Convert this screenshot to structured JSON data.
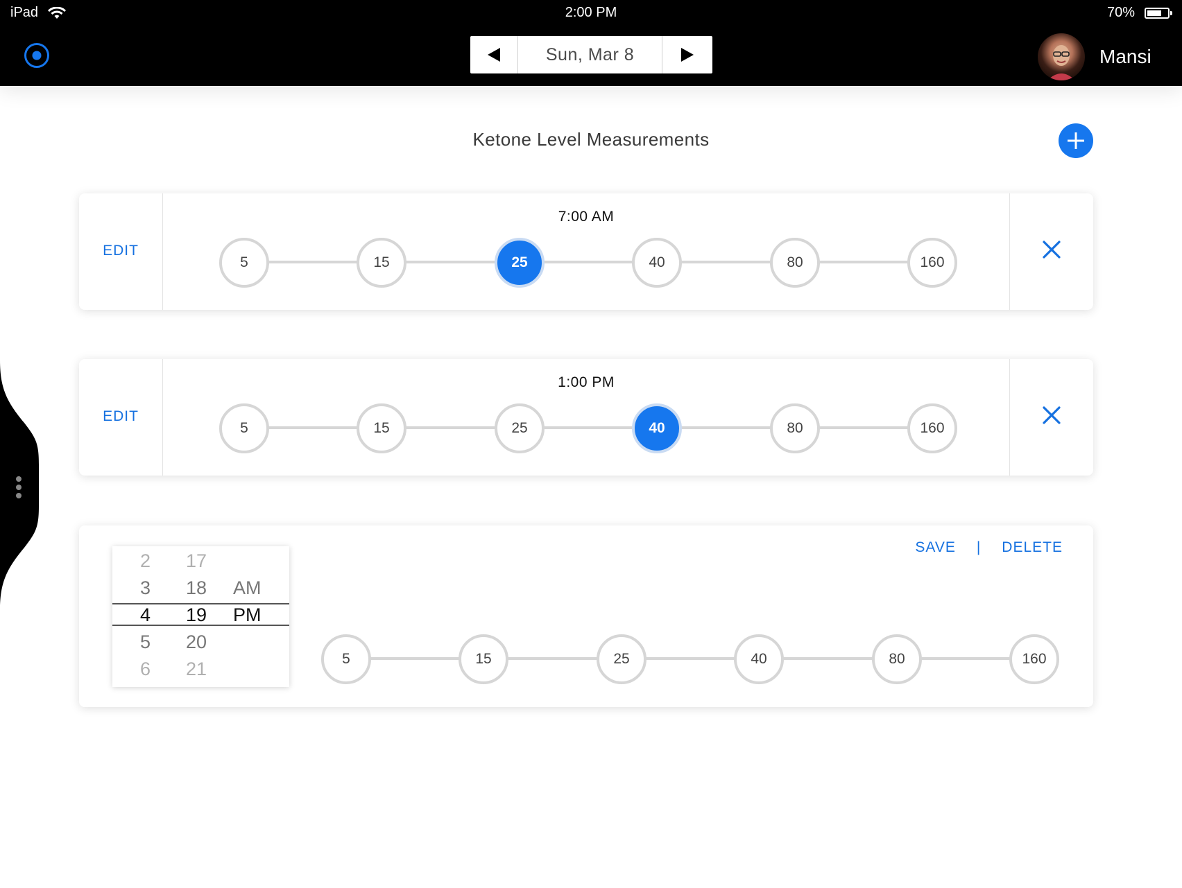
{
  "status_bar": {
    "device": "iPad",
    "time": "2:00 PM",
    "battery": "70%",
    "battery_level": 0.7
  },
  "header": {
    "date": "Sun, Mar 8",
    "user_name": "Mansi",
    "icons": {
      "logo": "target-ring-icon",
      "prev": "triangle-left-icon",
      "next": "triangle-right-icon",
      "wifi": "wifi-icon",
      "battery": "battery-icon"
    }
  },
  "page": {
    "title": "Ketone Level Measurements",
    "add_icon": "plus-icon",
    "accent_color": "#1677ee"
  },
  "scale_values": [
    "5",
    "15",
    "25",
    "40",
    "80",
    "160"
  ],
  "entries": [
    {
      "time": "7:00 AM",
      "edit_label": "EDIT",
      "selected": "25",
      "remove_icon": "close-x-icon"
    },
    {
      "time": "1:00 PM",
      "edit_label": "EDIT",
      "selected": "40",
      "remove_icon": "close-x-icon"
    }
  ],
  "new_entry": {
    "save_label": "SAVE",
    "separator": "|",
    "delete_label": "DELETE",
    "time_picker": {
      "hours": [
        "2",
        "3",
        "4",
        "5",
        "6"
      ],
      "minutes": [
        "17",
        "18",
        "19",
        "20",
        "21"
      ],
      "periods": [
        "AM",
        "PM"
      ],
      "selected": {
        "hour": "4",
        "minute": "19",
        "period": "PM"
      }
    }
  }
}
